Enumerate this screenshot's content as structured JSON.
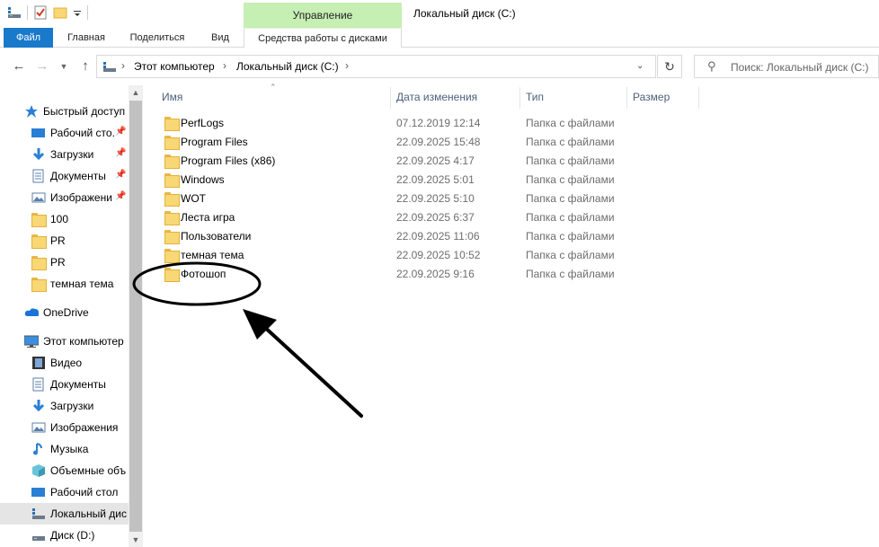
{
  "titlebar": {
    "manage_tab": "Управление",
    "window_title": "Локальный диск (C:)"
  },
  "ribbon": {
    "tabs": [
      "Файл",
      "Главная",
      "Поделиться",
      "Вид"
    ],
    "disk_tools": "Средства работы с дисками"
  },
  "address": {
    "crumbs": [
      "Этот компьютер",
      "Локальный диск (C:)"
    ],
    "search_placeholder": "Поиск: Локальный диск (C:)"
  },
  "nav": {
    "quick_access": "Быстрый доступ",
    "quick_items": [
      "Рабочий сто.",
      "Загрузки",
      "Документы",
      "Изображени",
      "100",
      "PR",
      "PR",
      "темная тема"
    ],
    "onedrive": "OneDrive",
    "this_pc": "Этот компьютер",
    "pc_items": [
      "Видео",
      "Документы",
      "Загрузки",
      "Изображения",
      "Музыка",
      "Объемные объ",
      "Рабочий стол",
      "Локальный дис",
      "Диск (D:)"
    ]
  },
  "columns": {
    "name": "Имя",
    "date": "Дата изменения",
    "type": "Тип",
    "size": "Размер"
  },
  "files": [
    {
      "name": "PerfLogs",
      "date": "07.12.2019 12:14",
      "type": "Папка с файлами"
    },
    {
      "name": "Program Files",
      "date": "22.09.2025 15:48",
      "type": "Папка с файлами"
    },
    {
      "name": "Program Files (x86)",
      "date": "22.09.2025 4:17",
      "type": "Папка с файлами"
    },
    {
      "name": "Windows",
      "date": "22.09.2025 5:01",
      "type": "Папка с файлами"
    },
    {
      "name": "WOT",
      "date": "22.09.2025 5:10",
      "type": "Папка с файлами"
    },
    {
      "name": "Леста игра",
      "date": "22.09.2025 6:37",
      "type": "Папка с файлами"
    },
    {
      "name": "Пользователи",
      "date": "22.09.2025 11:06",
      "type": "Папка с файлами"
    },
    {
      "name": "темная тема",
      "date": "22.09.2025 10:52",
      "type": "Папка с файлами"
    },
    {
      "name": "Фотошоп",
      "date": "22.09.2025 9:16",
      "type": "Папка с файлами"
    }
  ],
  "colors": {
    "file_tab": "#1979ca",
    "manage_tab": "#c6efb4",
    "folder": "#f8d775"
  }
}
